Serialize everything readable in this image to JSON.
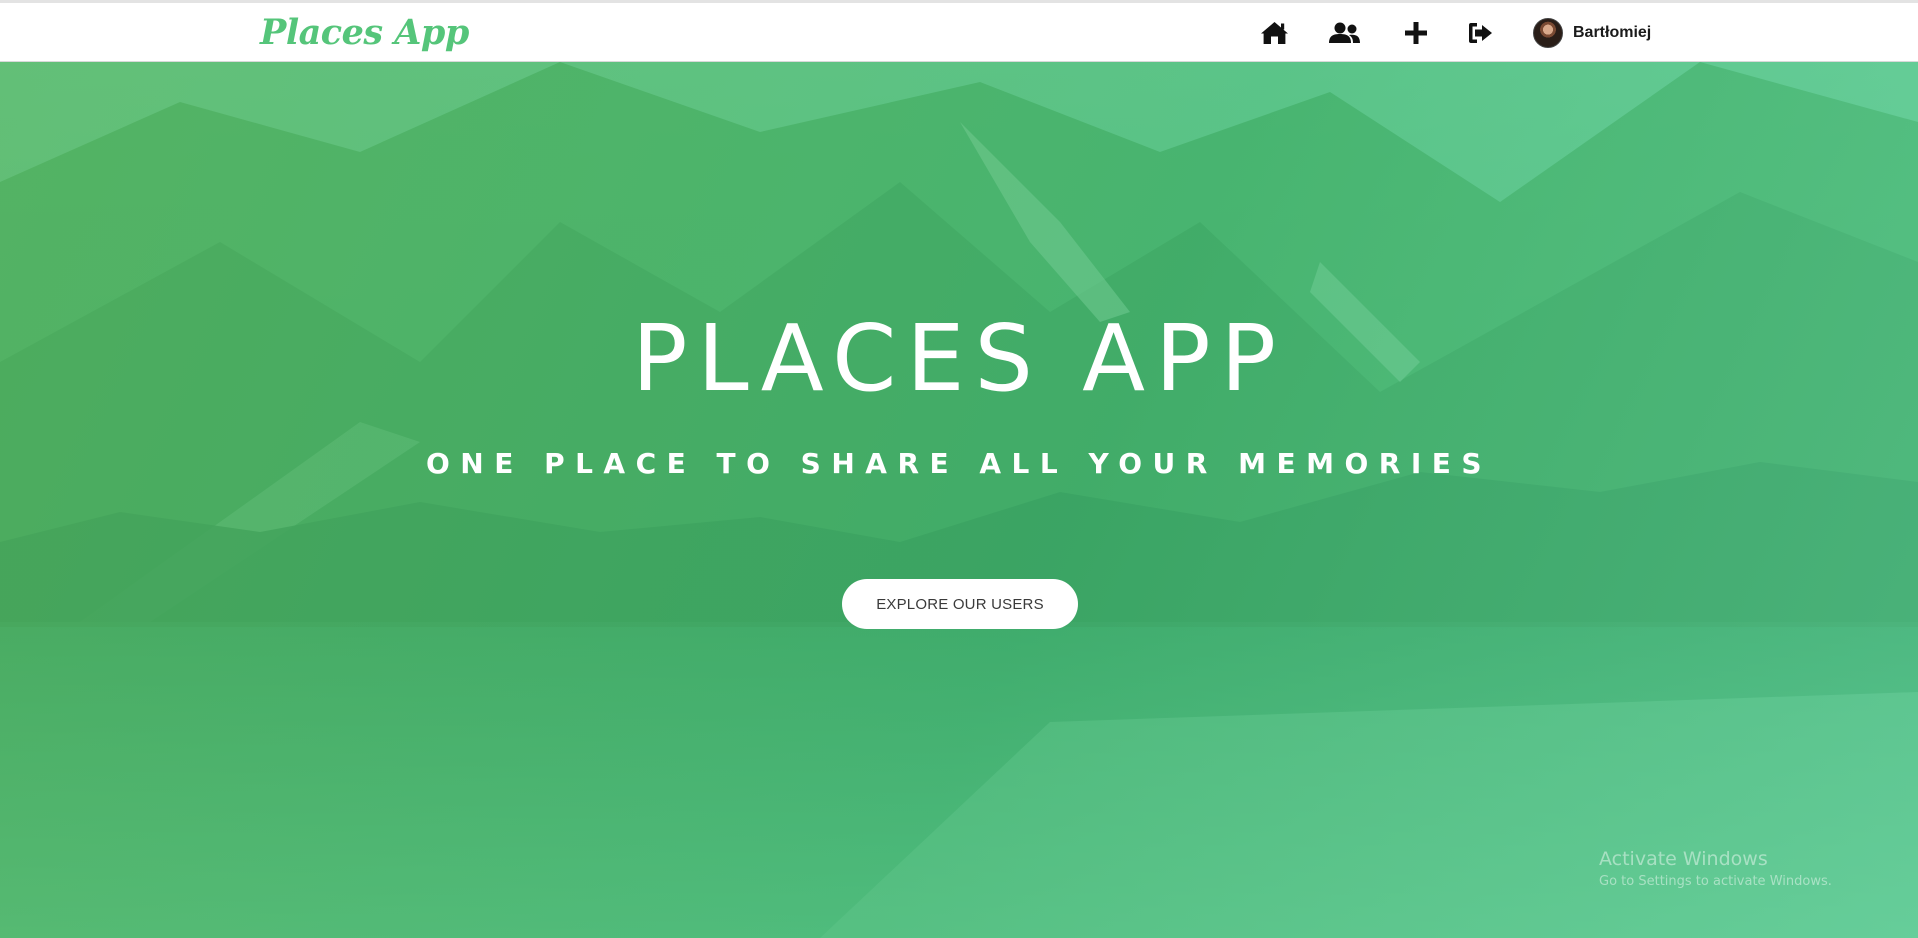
{
  "navbar": {
    "logo": "Places App",
    "icons": [
      {
        "name": "home-icon",
        "label": "Home"
      },
      {
        "name": "users-icon",
        "label": "Users"
      },
      {
        "name": "plus-icon",
        "label": "Add place"
      },
      {
        "name": "logout-icon",
        "label": "Logout"
      }
    ],
    "user": {
      "name": "Bartłomiej"
    }
  },
  "hero": {
    "title": "PLACES APP",
    "subtitle": "ONE PLACE TO SHARE ALL YOUR MEMORIES",
    "button_label": "EXPLORE OUR USERS"
  },
  "watermark": {
    "line1": "Activate Windows",
    "line2": "Go to Settings to activate Windows."
  },
  "colors": {
    "brand": "#55c57a",
    "overlay": "#48be78",
    "text_dark": "#1b1b1b",
    "button_bg": "#ffffff"
  }
}
